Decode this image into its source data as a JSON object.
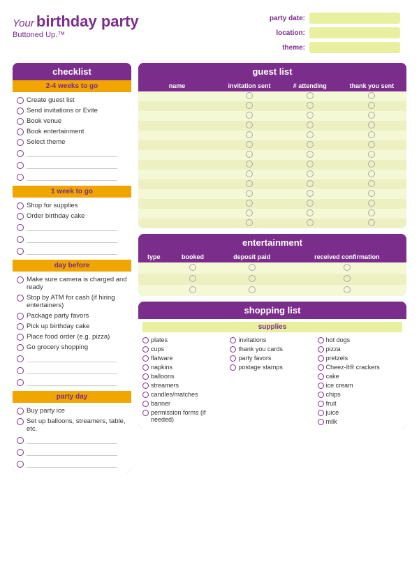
{
  "header": {
    "your": "Your",
    "main": "birthday party",
    "subtitle": "Buttoned Up.™",
    "fields": [
      {
        "label": "party date:",
        "id": "party-date"
      },
      {
        "label": "location:",
        "id": "location"
      },
      {
        "label": "theme:",
        "id": "theme"
      }
    ]
  },
  "checklist": {
    "title": "checklist",
    "sections": [
      {
        "header": "2-4 weeks to go",
        "items": [
          "Create guest list",
          "Send invitations or Evite",
          "Book venue",
          "Book entertainment",
          "Select theme"
        ],
        "blanks": 3
      },
      {
        "header": "1 week to go",
        "items": [
          "Shop for supplies",
          "Order birthday cake"
        ],
        "blanks": 3
      },
      {
        "header": "day before",
        "items": [
          "Make sure camera is charged and ready",
          "Stop by ATM for cash (if hiring entertainers)",
          "Package party favors",
          "Pick up birthday cake",
          "Place food order (e.g. pizza)",
          "Go grocery shopping"
        ],
        "blanks": 3
      },
      {
        "header": "party day",
        "items": [
          "Buy party ice",
          "Set up balloons, streamers, table, etc."
        ],
        "blanks": 3
      }
    ]
  },
  "guest_list": {
    "title": "guest list",
    "columns": [
      "name",
      "invitation sent",
      "# attending",
      "thank you sent"
    ],
    "rows": 14
  },
  "entertainment": {
    "title": "entertainment",
    "columns": [
      "type",
      "booked",
      "deposit paid",
      "received confirmation"
    ],
    "rows": 3
  },
  "shopping_list": {
    "title": "shopping list",
    "supplies_header": "supplies",
    "columns": [
      {
        "items": [
          "plates",
          "cups",
          "flatware",
          "napkins",
          "balloons",
          "streamers",
          "candles/matches",
          "banner",
          "permission forms (if needed)"
        ]
      },
      {
        "items": [
          "invitations",
          "thank you cards",
          "party favors",
          "postage stamps"
        ]
      },
      {
        "items": [
          "hot dogs",
          "pizza",
          "pretzels",
          "Cheez-It® crackers",
          "cake",
          "ice cream",
          "chips",
          "fruit",
          "juice",
          "milk"
        ]
      }
    ]
  }
}
